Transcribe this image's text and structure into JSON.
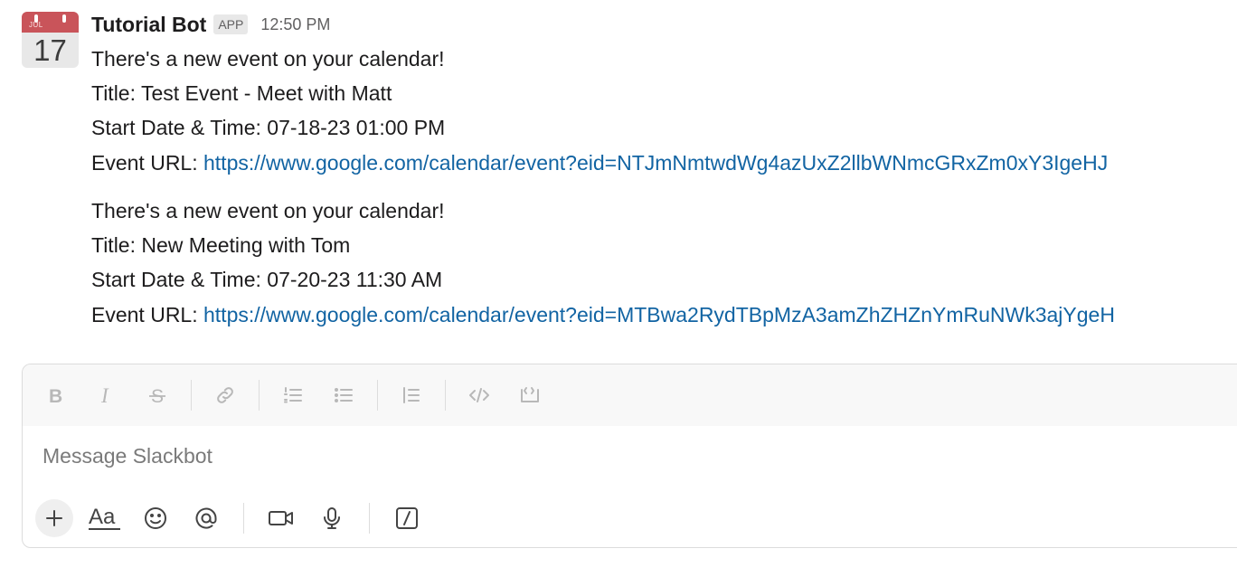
{
  "message": {
    "avatar_month": "JUL",
    "avatar_day": "17",
    "author": "Tutorial Bot",
    "badge": "APP",
    "time": "12:50 PM",
    "events": [
      {
        "intro": "There's a new event on your calendar!",
        "title": "Title: Test Event - Meet with Matt",
        "start": "Start Date & Time: 07-18-23 01:00 PM",
        "url_label": "Event URL: ",
        "url": "https://www.google.com/calendar/event?eid=NTJmNmtwdWg4azUxZ2llbWNmcGRxZm0xY3IgeHJ"
      },
      {
        "intro": "There's a new event on your calendar!",
        "title": "Title: New Meeting with Tom",
        "start": "Start Date & Time: 07-20-23 11:30 AM",
        "url_label": "Event URL: ",
        "url": "https://www.google.com/calendar/event?eid=MTBwa2RydTBpMzA3amZhZHZnYmRuNWk3ajYgeH"
      }
    ]
  },
  "composer": {
    "placeholder": "Message Slackbot",
    "format_buttons": [
      "bold-icon",
      "italic-icon",
      "strikethrough-icon",
      "link-icon",
      "ordered-list-icon",
      "bulleted-list-icon",
      "blockquote-icon",
      "code-icon",
      "code-block-icon"
    ],
    "action_buttons": [
      "plus-icon",
      "text-format-icon",
      "emoji-icon",
      "mention-icon",
      "video-icon",
      "microphone-icon",
      "slash-command-icon"
    ],
    "text_format_label": "Aa"
  },
  "colors": {
    "link": "#1264a3",
    "avatar_band": "#c9545a"
  }
}
